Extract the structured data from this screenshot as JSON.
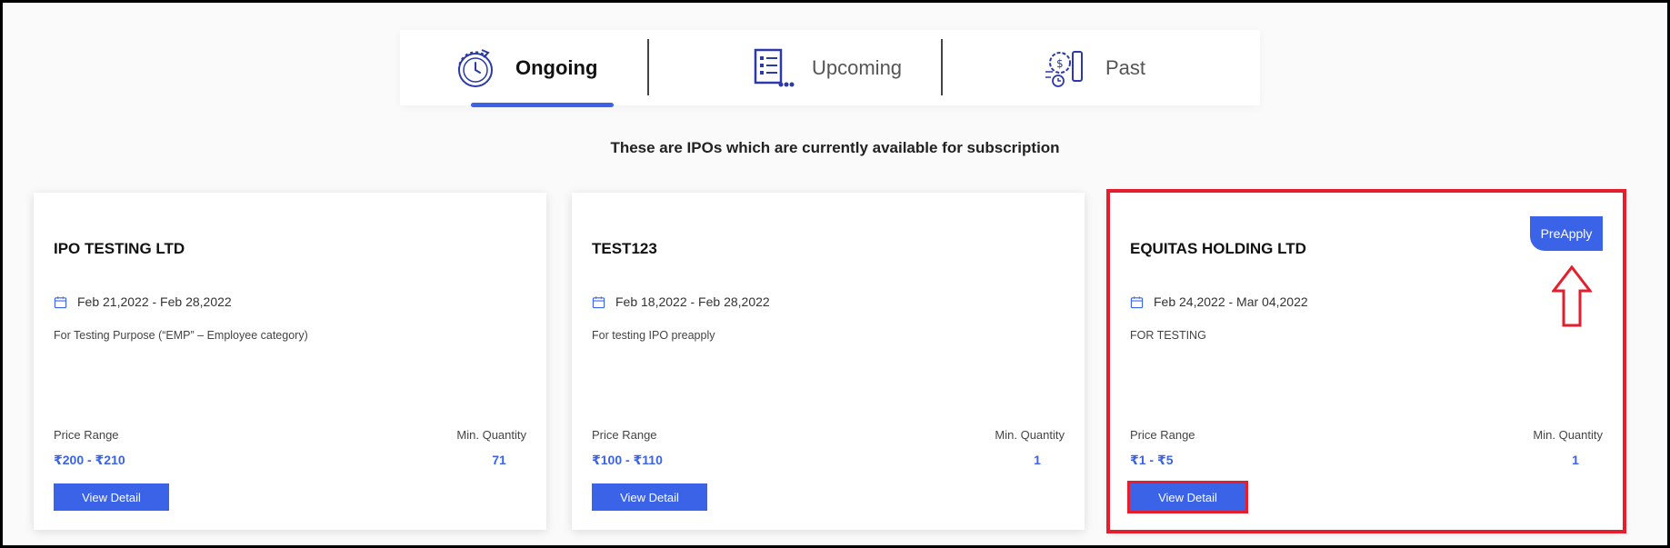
{
  "tabs": [
    {
      "label": "Ongoing",
      "active": true,
      "icon": "clock-refresh-icon"
    },
    {
      "label": "Upcoming",
      "active": false,
      "icon": "list-document-icon"
    },
    {
      "label": "Past",
      "active": false,
      "icon": "gear-document-icon"
    }
  ],
  "subtitle": "These are IPOs which are currently available for subscription",
  "cards": [
    {
      "title": "IPO TESTING LTD",
      "date": "Feb 21,2022 - Feb 28,2022",
      "description": "For Testing Purpose (“EMP” – Employee category)",
      "price_label": "Price Range",
      "price_value": "₹200 - ₹210",
      "qty_label": "Min. Quantity",
      "qty_value": "71",
      "button": "View Detail"
    },
    {
      "title": "TEST123",
      "date": "Feb 18,2022 - Feb 28,2022",
      "description": "For testing IPO preapply",
      "price_label": "Price Range",
      "price_value": "₹100 - ₹110",
      "qty_label": "Min. Quantity",
      "qty_value": "1",
      "button": "View Detail"
    },
    {
      "title": "EQUITAS HOLDING LTD",
      "date": "Feb 24,2022 - Mar 04,2022",
      "description": "FOR TESTING",
      "price_label": "Price Range",
      "price_value": "₹1 - ₹5",
      "qty_label": "Min. Quantity",
      "qty_value": "1",
      "button": "View Detail",
      "badge": "PreApply"
    }
  ],
  "colors": {
    "accent": "#3b63e8",
    "highlight": "#e41e2d"
  }
}
